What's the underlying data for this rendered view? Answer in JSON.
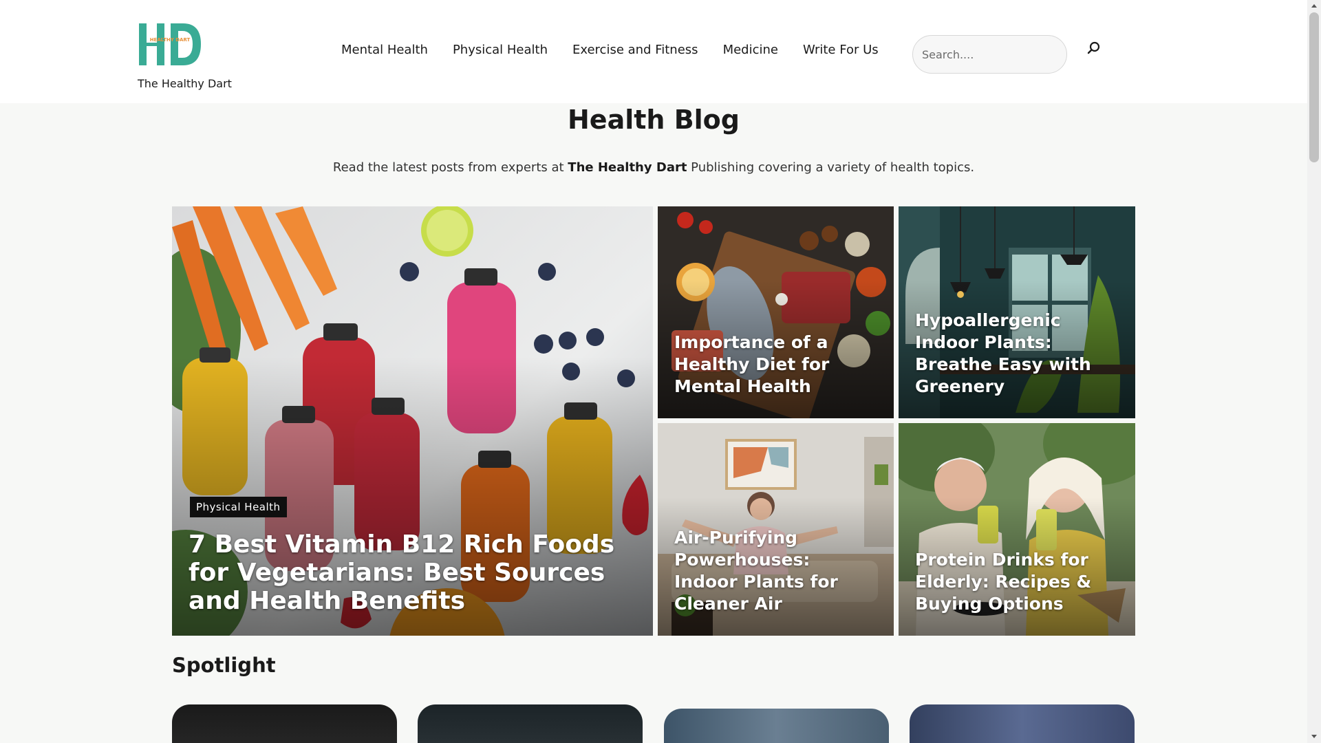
{
  "brand": {
    "name": "The Healthy Dart",
    "logo_letters": "HD",
    "logo_subtext": "HEALTHY DART",
    "primary_color": "#3aab95",
    "accent_color": "#e8913a"
  },
  "nav": {
    "items": [
      {
        "label": "Mental Health"
      },
      {
        "label": "Physical Health"
      },
      {
        "label": "Exercise and Fitness"
      },
      {
        "label": "Medicine"
      },
      {
        "label": "Write For Us"
      }
    ]
  },
  "search": {
    "placeholder": "Search....",
    "icon": "search-icon"
  },
  "hero": {
    "title": "Health Blog",
    "subtitle_before": "Read the latest posts from experts at ",
    "subtitle_brand": "The Healthy Dart",
    "subtitle_after": " Publishing covering a variety of health topics."
  },
  "featured": {
    "main": {
      "category": "Physical Health",
      "title": "7 Best Vitamin B12 Rich Foods for Vegetarians: Best Sources and Health Benefits"
    },
    "side": [
      {
        "title": "Importance of a Healthy Diet for Mental Health"
      },
      {
        "title": "Hypoallergenic Indoor Plants: Breathe Easy with Greenery"
      },
      {
        "title": "Air-Purifying Powerhouses: Indoor Plants for Cleaner Air"
      },
      {
        "title": "Protein Drinks for Elderly: Recipes & Buying Options"
      }
    ]
  },
  "spotlight": {
    "heading": "Spotlight"
  }
}
